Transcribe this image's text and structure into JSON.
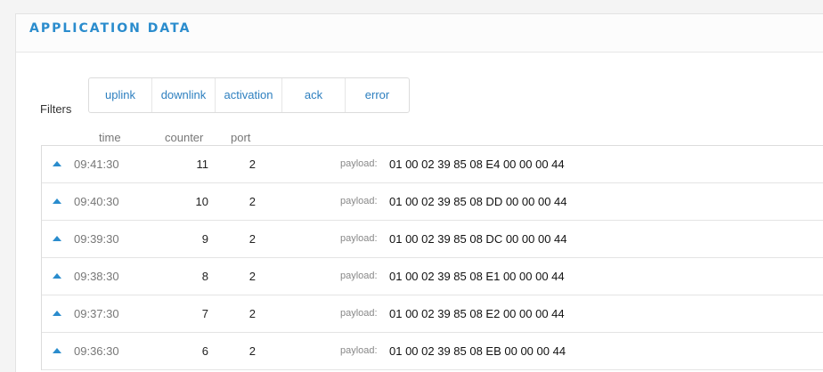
{
  "panel": {
    "title": "APPLICATION DATA"
  },
  "filters": {
    "label": "Filters",
    "buttons": [
      "uplink",
      "downlink",
      "activation",
      "ack",
      "error"
    ]
  },
  "columns": {
    "time": "time",
    "counter": "counter",
    "port": "port"
  },
  "rows": [
    {
      "time": "09:41:30",
      "counter": "11",
      "port": "2",
      "payload_label": "payload:",
      "payload": "01 00 02 39 85 08 E4 00 00 00 44"
    },
    {
      "time": "09:40:30",
      "counter": "10",
      "port": "2",
      "payload_label": "payload:",
      "payload": "01 00 02 39 85 08 DD 00 00 00 44"
    },
    {
      "time": "09:39:30",
      "counter": "9",
      "port": "2",
      "payload_label": "payload:",
      "payload": "01 00 02 39 85 08 DC 00 00 00 44"
    },
    {
      "time": "09:38:30",
      "counter": "8",
      "port": "2",
      "payload_label": "payload:",
      "payload": "01 00 02 39 85 08 E1 00 00 00 44"
    },
    {
      "time": "09:37:30",
      "counter": "7",
      "port": "2",
      "payload_label": "payload:",
      "payload": "01 00 02 39 85 08 E2 00 00 00 44"
    },
    {
      "time": "09:36:30",
      "counter": "6",
      "port": "2",
      "payload_label": "payload:",
      "payload": "01 00 02 39 85 08 EB 00 00 00 44"
    }
  ],
  "icons": {
    "expand": "triangle-up-icon"
  },
  "colors": {
    "accent": "#2a8ccd",
    "link": "#2d7fbf"
  }
}
